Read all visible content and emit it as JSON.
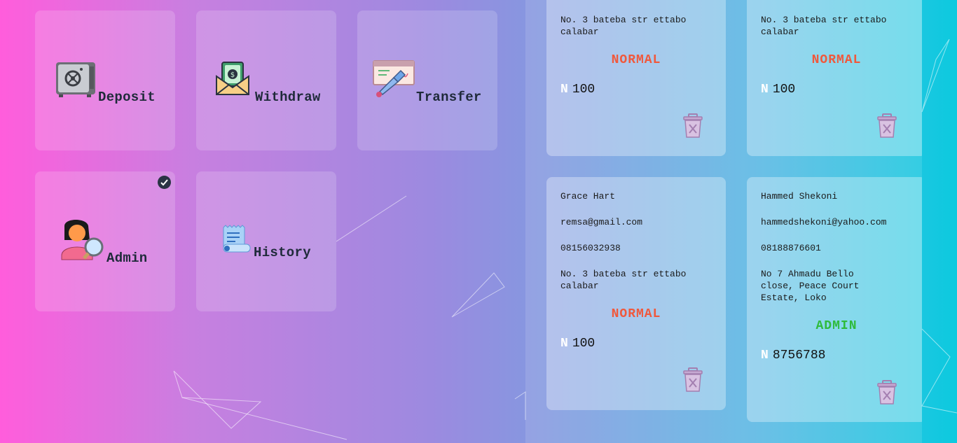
{
  "menu": [
    {
      "label": "Deposit"
    },
    {
      "label": "Withdraw"
    },
    {
      "label": "Transfer"
    },
    {
      "label": "Admin",
      "selected": true
    },
    {
      "label": "History"
    }
  ],
  "currency_symbol": "N",
  "users": [
    {
      "address": "No. 3 bateba str ettabo calabar",
      "role": "NORMAL",
      "balance": "100"
    },
    {
      "address": "No. 3 bateba str ettabo calabar",
      "role": "NORMAL",
      "balance": "100"
    },
    {
      "name": "Grace Hart",
      "email": "remsa@gmail.com",
      "phone": "08156032938",
      "address": "No. 3 bateba str ettabo calabar",
      "role": "NORMAL",
      "balance": "100"
    },
    {
      "name": "Hammed Shekoni",
      "email": "hammedshekoni@yahoo.com",
      "phone": "08188876601",
      "address": "No 7 Ahmadu Bello close, Peace Court Estate, Loko",
      "role": "ADMIN",
      "balance": "8756788"
    }
  ],
  "colors": {
    "normal_role": "#f0583c",
    "admin_role": "#2fbb3c"
  }
}
